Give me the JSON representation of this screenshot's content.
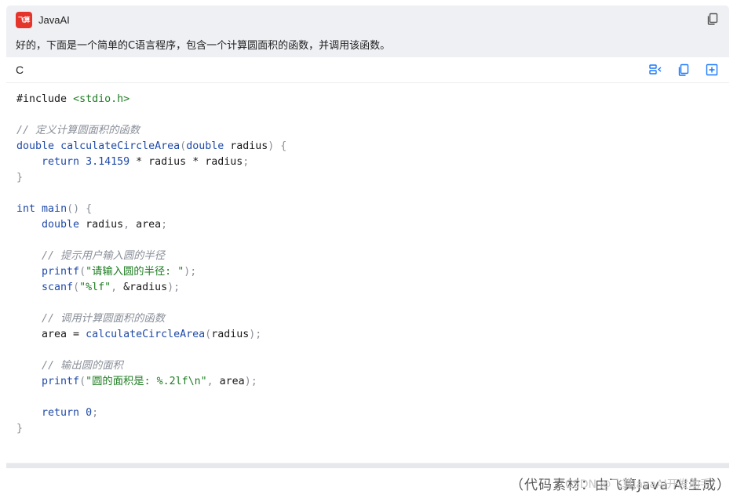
{
  "header": {
    "app_logo_text": "飞算",
    "app_title": "JavaAI",
    "message": "好的，下面是一个简单的C语言程序，包含一个计算圆面积的函数，并调用该函数。"
  },
  "code_block": {
    "language": "C",
    "lines": [
      [
        {
          "t": "#include ",
          "c": "plain"
        },
        {
          "t": "<stdio.h>",
          "c": "str"
        }
      ],
      [],
      [
        {
          "t": "// 定义计算圆面积的函数",
          "c": "cm"
        }
      ],
      [
        {
          "t": "double",
          "c": "kw"
        },
        {
          "t": " ",
          "c": "plain"
        },
        {
          "t": "calculateCircleArea",
          "c": "fn"
        },
        {
          "t": "(",
          "c": "p"
        },
        {
          "t": "double",
          "c": "kw"
        },
        {
          "t": " radius",
          "c": "plain"
        },
        {
          "t": ") {",
          "c": "p"
        }
      ],
      [
        {
          "t": "    ",
          "c": "plain"
        },
        {
          "t": "return",
          "c": "kw"
        },
        {
          "t": " ",
          "c": "plain"
        },
        {
          "t": "3.14159",
          "c": "num"
        },
        {
          "t": " * radius * radius",
          "c": "plain"
        },
        {
          "t": ";",
          "c": "p"
        }
      ],
      [
        {
          "t": "}",
          "c": "p"
        }
      ],
      [],
      [
        {
          "t": "int",
          "c": "kw"
        },
        {
          "t": " ",
          "c": "plain"
        },
        {
          "t": "main",
          "c": "fn"
        },
        {
          "t": "() {",
          "c": "p"
        }
      ],
      [
        {
          "t": "    ",
          "c": "plain"
        },
        {
          "t": "double",
          "c": "kw"
        },
        {
          "t": " radius",
          "c": "plain"
        },
        {
          "t": ",",
          "c": "p"
        },
        {
          "t": " area",
          "c": "plain"
        },
        {
          "t": ";",
          "c": "p"
        }
      ],
      [],
      [
        {
          "t": "    ",
          "c": "plain"
        },
        {
          "t": "// 提示用户输入圆的半径",
          "c": "cm"
        }
      ],
      [
        {
          "t": "    ",
          "c": "plain"
        },
        {
          "t": "printf",
          "c": "fn"
        },
        {
          "t": "(",
          "c": "p"
        },
        {
          "t": "\"请输入圆的半径: \"",
          "c": "str"
        },
        {
          "t": ");",
          "c": "p"
        }
      ],
      [
        {
          "t": "    ",
          "c": "plain"
        },
        {
          "t": "scanf",
          "c": "fn"
        },
        {
          "t": "(",
          "c": "p"
        },
        {
          "t": "\"%lf\"",
          "c": "str"
        },
        {
          "t": ",",
          "c": "p"
        },
        {
          "t": " &radius",
          "c": "plain"
        },
        {
          "t": ");",
          "c": "p"
        }
      ],
      [],
      [
        {
          "t": "    ",
          "c": "plain"
        },
        {
          "t": "// 调用计算圆面积的函数",
          "c": "cm"
        }
      ],
      [
        {
          "t": "    area = ",
          "c": "plain"
        },
        {
          "t": "calculateCircleArea",
          "c": "fn"
        },
        {
          "t": "(",
          "c": "p"
        },
        {
          "t": "radius",
          "c": "plain"
        },
        {
          "t": ");",
          "c": "p"
        }
      ],
      [],
      [
        {
          "t": "    ",
          "c": "plain"
        },
        {
          "t": "// 输出圆的面积",
          "c": "cm"
        }
      ],
      [
        {
          "t": "    ",
          "c": "plain"
        },
        {
          "t": "printf",
          "c": "fn"
        },
        {
          "t": "(",
          "c": "p"
        },
        {
          "t": "\"圆的面积是: %.2lf\\n\"",
          "c": "str"
        },
        {
          "t": ",",
          "c": "p"
        },
        {
          "t": " area",
          "c": "plain"
        },
        {
          "t": ");",
          "c": "p"
        }
      ],
      [],
      [
        {
          "t": "    ",
          "c": "plain"
        },
        {
          "t": "return",
          "c": "kw"
        },
        {
          "t": " ",
          "c": "plain"
        },
        {
          "t": "0",
          "c": "num"
        },
        {
          "t": ";",
          "c": "p"
        }
      ],
      [
        {
          "t": "}",
          "c": "p"
        }
      ]
    ]
  },
  "icons": {
    "copy_message": "copy-icon",
    "insert_to_editor": "insert-code-icon",
    "copy_code": "copy-icon",
    "new_file": "new-file-icon"
  },
  "footer": {
    "caption": "（代码素材：由飞算Java AI生成）",
    "watermark": "CSDN @飞算JavaAI开发助手"
  },
  "colors": {
    "accent": "#1677ff",
    "logo": "#e5352b",
    "keyword": "#1f4aa8",
    "string": "#1e7d22",
    "comment": "#8a8f99"
  }
}
